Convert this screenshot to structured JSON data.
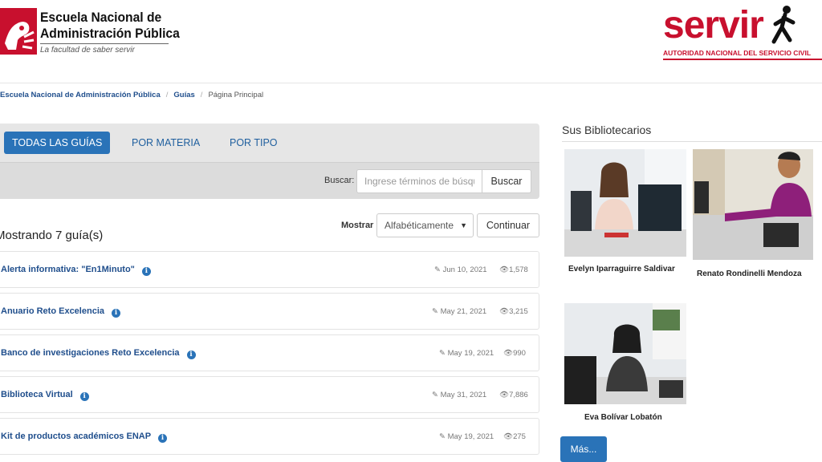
{
  "header": {
    "brand_line1": "Escuela Nacional de",
    "brand_line2": "Administración Pública",
    "tagline": "La facultad de saber servir",
    "partner_word": "servir",
    "partner_subtitle": "AUTORIDAD NACIONAL DEL SERVICIO CIVIL",
    "accent_color": "#c8102e"
  },
  "breadcrumb": [
    {
      "label": "Escuela Nacional de Administración Pública"
    },
    {
      "label": "Guías"
    },
    {
      "label": "Página Principal"
    }
  ],
  "tabs": [
    {
      "label": "TODAS LAS GUÍAS",
      "active": true
    },
    {
      "label": "POR MATERIA",
      "active": false
    },
    {
      "label": "POR TIPO",
      "active": false
    }
  ],
  "search": {
    "label": "Buscar:",
    "placeholder": "Ingrese términos de búsqueda",
    "button": "Buscar"
  },
  "listing": {
    "count_text": "Mostrando 7 guía(s)",
    "show_label": "Mostrar",
    "sort_value": "Alfabéticamente",
    "continue_label": "Continuar"
  },
  "guides": [
    {
      "title": "Alerta informativa: \"En1Minuto\"",
      "date": "Jun 10, 2021",
      "views": "1,578"
    },
    {
      "title": "Anuario Reto Excelencia",
      "date": "May 21, 2021",
      "views": "3,215"
    },
    {
      "title": "Banco de investigaciones Reto Excelencia",
      "date": "May 19, 2021",
      "views": "990"
    },
    {
      "title": "Biblioteca Virtual",
      "date": "May 31, 2021",
      "views": "7,886"
    },
    {
      "title": "Kit de productos académicos ENAP",
      "date": "May 19, 2021",
      "views": "275"
    }
  ],
  "sidebar": {
    "heading": "Sus Bibliotecarios",
    "librarians": [
      {
        "name": "Evelyn Iparraguirre Saldivar"
      },
      {
        "name": "Renato Rondinelli Mendoza"
      },
      {
        "name": "Eva Bolívar Lobatón"
      }
    ],
    "more_label": "Más..."
  }
}
